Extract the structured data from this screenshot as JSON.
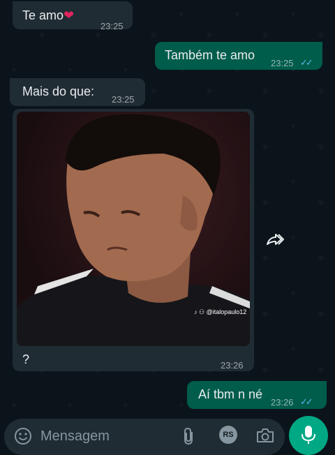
{
  "messages": [
    {
      "text": "Te amo",
      "time": "23:25",
      "direction": "in",
      "emoji": "heart-icon"
    },
    {
      "text": "Também te amo",
      "time": "23:25",
      "direction": "out",
      "status": "read"
    },
    {
      "text": "Mais do que:",
      "time": "23:25",
      "direction": "in"
    },
    {
      "caption": "?",
      "time": "23:26",
      "direction": "in",
      "image_watermark": "♪ ⚇ @italopaulo12"
    },
    {
      "text": "Aí tbm n né",
      "time": "23:26",
      "direction": "out",
      "status": "read"
    }
  ],
  "input": {
    "placeholder": "Mensagem",
    "badge": "RS"
  },
  "colors": {
    "background": "#0b141a",
    "incoming_bubble": "#202c33",
    "outgoing_bubble": "#005c4b",
    "read_ticks": "#53bdeb",
    "mic_button": "#00a884"
  }
}
